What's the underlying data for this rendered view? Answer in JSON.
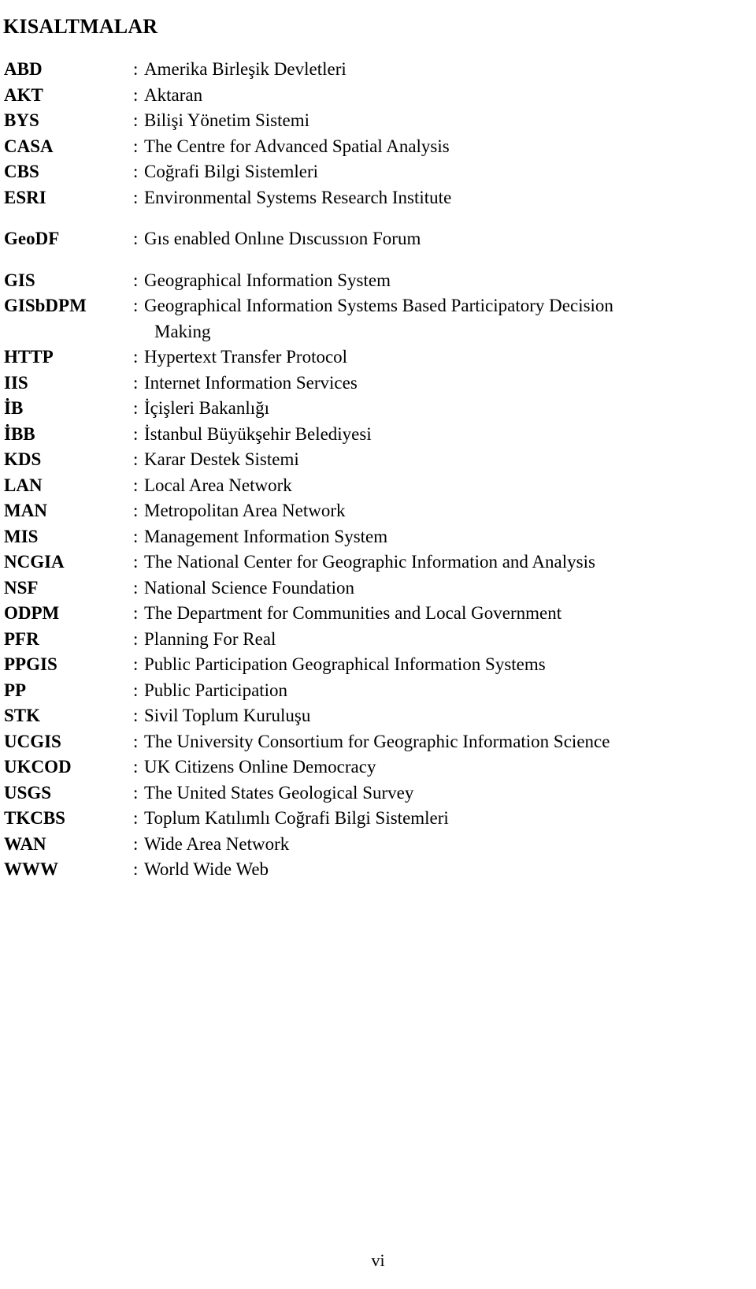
{
  "document": {
    "title": "KISALTMALAR",
    "page_number": "vi",
    "separator": ":"
  },
  "abbreviations": [
    {
      "term": "ABD",
      "definition": "Amerika Birleşik Devletleri",
      "gap_before": false
    },
    {
      "term": "AKT",
      "definition": "Aktaran",
      "gap_before": false
    },
    {
      "term": "BYS",
      "definition": "Bilişi Yönetim Sistemi",
      "gap_before": false
    },
    {
      "term": "CASA",
      "definition": "The Centre for Advanced Spatial Analysis",
      "gap_before": false
    },
    {
      "term": "CBS",
      "definition": "Coğrafi Bilgi Sistemleri",
      "gap_before": false
    },
    {
      "term": "ESRI",
      "definition": "Environmental Systems Research Institute",
      "gap_before": false
    },
    {
      "term": "GeoDF",
      "definition": "Gıs enabled Onlıne Dıscussıon Forum",
      "gap_before": true
    },
    {
      "term": "GIS",
      "definition": "Geographical Information System",
      "gap_before": true
    },
    {
      "term": "GISbDPM",
      "definition": "Geographical Information Systems Based Participatory Decision",
      "continuation": "Making",
      "gap_before": false
    },
    {
      "term": "HTTP",
      "definition": "Hypertext Transfer Protocol",
      "gap_before": false
    },
    {
      "term": "IIS",
      "definition": "Internet Information Services",
      "gap_before": false
    },
    {
      "term": "İB",
      "definition": "İçişleri Bakanlığı",
      "gap_before": false
    },
    {
      "term": "İBB",
      "definition": "İstanbul Büyükşehir Belediyesi",
      "gap_before": false
    },
    {
      "term": "KDS",
      "definition": "Karar Destek Sistemi",
      "gap_before": false
    },
    {
      "term": "LAN",
      "definition": "Local Area Network",
      "gap_before": false
    },
    {
      "term": "MAN",
      "definition": "Metropolitan Area Network",
      "gap_before": false
    },
    {
      "term": "MIS",
      "definition": "Management Information System",
      "gap_before": false
    },
    {
      "term": "NCGIA",
      "definition": "The National Center for Geographic Information and Analysis",
      "gap_before": false
    },
    {
      "term": "NSF",
      "definition": "National Science Foundation",
      "gap_before": false
    },
    {
      "term": "ODPM",
      "definition": "The Department for Communities and Local Government",
      "gap_before": false
    },
    {
      "term": "PFR",
      "definition": "Planning For Real",
      "gap_before": false
    },
    {
      "term": "PPGIS",
      "definition": "Public Participation Geographical Information Systems",
      "gap_before": false
    },
    {
      "term": "PP",
      "definition": "Public Participation",
      "gap_before": false
    },
    {
      "term": "STK",
      "definition": "Sivil Toplum Kuruluşu",
      "gap_before": false
    },
    {
      "term": "UCGIS",
      "definition": "The University Consortium for Geographic Information Science",
      "gap_before": false
    },
    {
      "term": "UKCOD",
      "definition": "UK Citizens Online Democracy",
      "gap_before": false
    },
    {
      "term": "USGS",
      "definition": "The United States Geological Survey",
      "gap_before": false
    },
    {
      "term": "TKCBS",
      "definition": "Toplum Katılımlı Coğrafi Bilgi Sistemleri",
      "gap_before": false
    },
    {
      "term": "WAN",
      "definition": "Wide Area Network",
      "gap_before": false
    },
    {
      "term": "WWW",
      "definition": "World Wide Web",
      "gap_before": false
    }
  ]
}
